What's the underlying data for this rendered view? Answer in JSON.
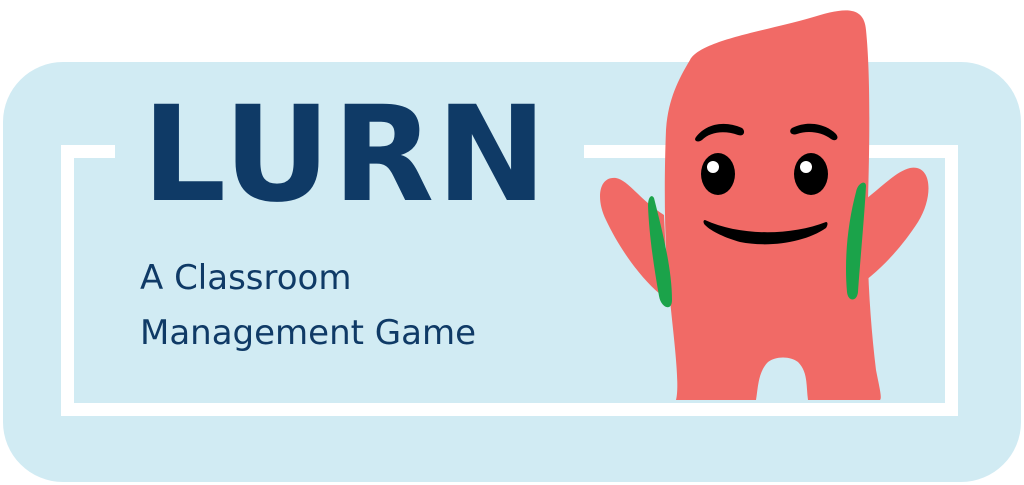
{
  "title": "LURN",
  "subtitle_line1": "A Classroom",
  "subtitle_line2": "Management Game",
  "colors": {
    "panel": "#d1ebf3",
    "frame": "#ffffff",
    "text": "#0f3a66",
    "mascot_body": "#f16a66",
    "mascot_straps": "#1ba34a",
    "mascot_features": "#000000"
  },
  "mascot": {
    "icon": "pink-monster-mascot"
  }
}
